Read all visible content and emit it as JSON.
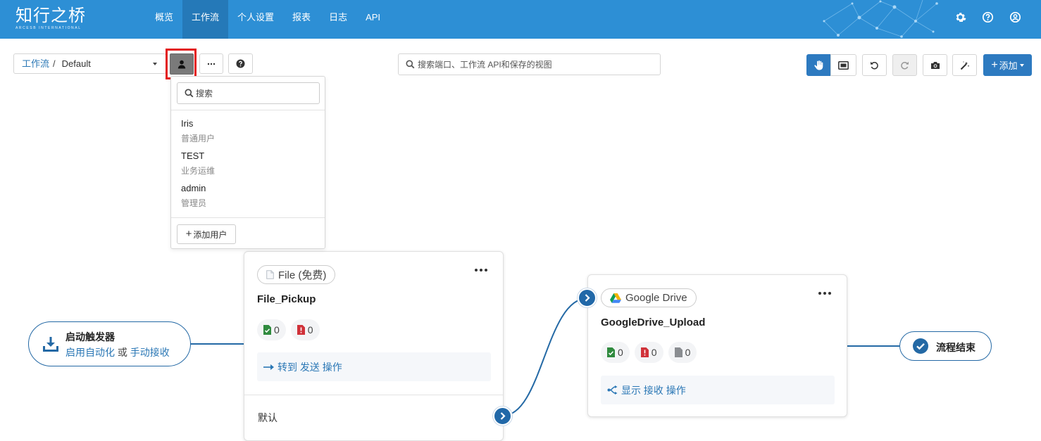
{
  "brand": {
    "name": "知行之桥",
    "subtitle": "ARCESB INTERNATIONAL"
  },
  "nav": {
    "items": [
      {
        "label": "概览",
        "active": false
      },
      {
        "label": "工作流",
        "active": true
      },
      {
        "label": "个人设置",
        "active": false
      },
      {
        "label": "报表",
        "active": false
      },
      {
        "label": "日志",
        "active": false
      },
      {
        "label": "API",
        "active": false
      }
    ]
  },
  "header_icons": [
    "gear-icon",
    "help-circle-icon",
    "user-circle-icon"
  ],
  "toolbar": {
    "workspace_link": "工作流",
    "workspace_separator": "/",
    "workspace_value": "Default",
    "search_placeholder": "搜索端口、工作流 API和保存的视图",
    "add_label": "添加"
  },
  "user_dropdown": {
    "search_placeholder": "搜索",
    "users": [
      {
        "name": "Iris",
        "role": "普通用户"
      },
      {
        "name": "TEST",
        "role": "业务运维"
      },
      {
        "name": "admin",
        "role": "管理员"
      }
    ],
    "add_user_label": "添加用户"
  },
  "flow": {
    "start": {
      "title": "启动触发器",
      "link1": "启用自动化",
      "connector": "或",
      "link2": "手动接收"
    },
    "end": {
      "title": "流程结束"
    },
    "nodes": [
      {
        "tag": "File (免费)",
        "name": "File_Pickup",
        "success": "0",
        "error": "0",
        "action": "转到 发送 操作",
        "output": "默认"
      },
      {
        "tag": "Google Drive",
        "name": "GoogleDrive_Upload",
        "success": "0",
        "error": "0",
        "pending": "0",
        "action": "显示 接收 操作"
      }
    ]
  },
  "colors": {
    "header": "#2d8fd5",
    "nav_active": "#2579b8",
    "primary": "#2d7ac0",
    "link": "#2a77b5",
    "highlight": "#e31b1b",
    "success": "#2f8a3e",
    "error": "#d0323a"
  }
}
